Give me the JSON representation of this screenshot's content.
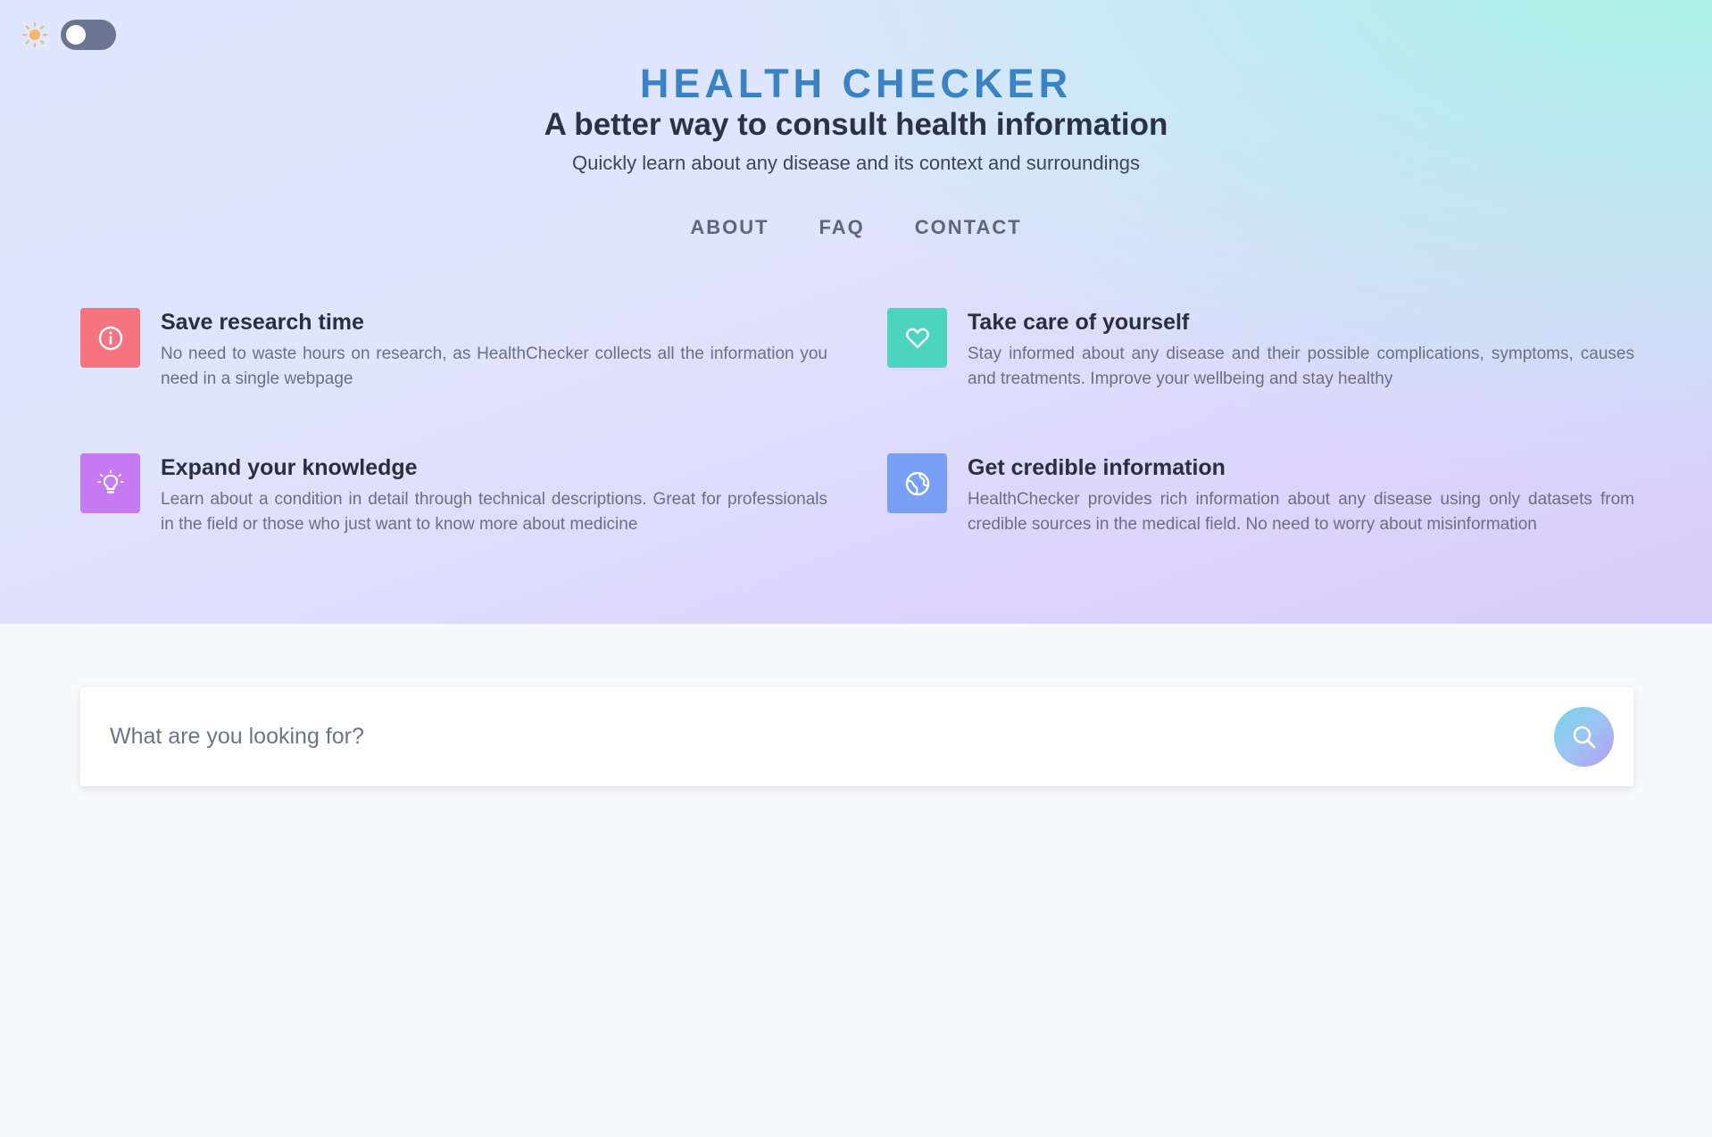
{
  "header": {
    "brand": "HEALTH CHECKER",
    "tagline": "A better way to consult health information",
    "subtagline": "Quickly learn about any disease and its context and surroundings"
  },
  "theme_toggle": {
    "icon": "sun-icon",
    "state": "light"
  },
  "nav": {
    "items": [
      {
        "label": "ABOUT"
      },
      {
        "label": "FAQ"
      },
      {
        "label": "CONTACT"
      }
    ]
  },
  "features": [
    {
      "icon": "info-icon",
      "color": "#f6747f",
      "title": "Save research time",
      "description": "No need to waste hours on research, as HealthChecker collects all the information you need in a single webpage"
    },
    {
      "icon": "heart-icon",
      "color": "#4dd4bf",
      "title": "Take care of yourself",
      "description": "Stay informed about any disease and their possible complications, symptoms, causes and treatments. Improve your wellbeing and stay healthy"
    },
    {
      "icon": "lightbulb-icon",
      "color": "#c579f3",
      "title": "Expand your knowledge",
      "description": "Learn about a condition in detail through technical descriptions. Great for professionals in the field or those who just want to know more about medicine"
    },
    {
      "icon": "globe-icon",
      "color": "#79a0f4",
      "title": "Get credible information",
      "description": "HealthChecker provides rich information about any disease using only datasets from credible sources in the medical field. No need to worry about misinformation"
    }
  ],
  "search": {
    "placeholder": "What are you looking for?",
    "value": "",
    "button_icon": "search-icon"
  },
  "colors": {
    "brand": "#3b82c4",
    "toggle_track": "#6b7491",
    "sun": "#f5b86a"
  }
}
